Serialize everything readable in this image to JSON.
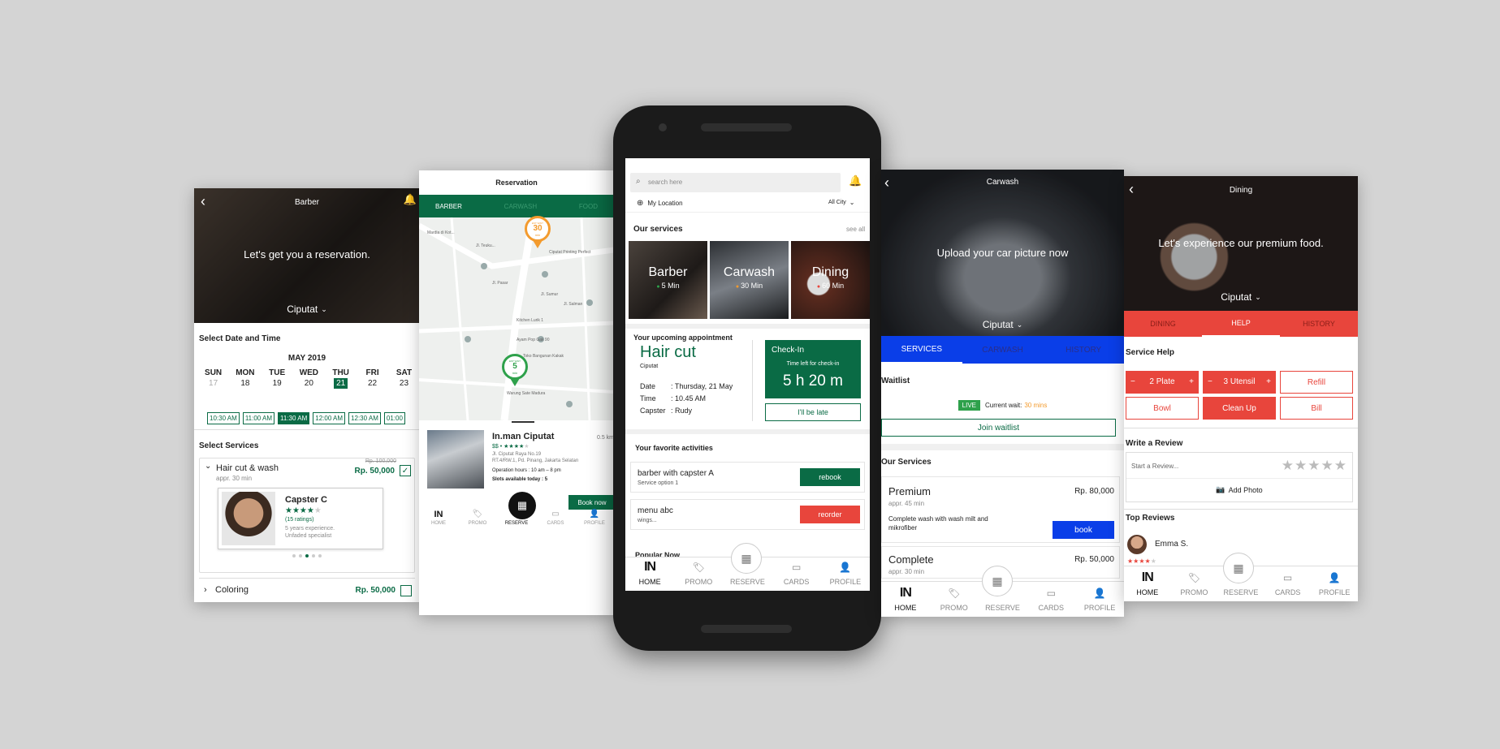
{
  "barber": {
    "title": "Barber",
    "hero_text": "Let's get you a reservation.",
    "location": "Ciputat",
    "section_date": "Select Date and Time",
    "month": "MAY  2019",
    "days": [
      "SUN",
      "MON",
      "TUE",
      "WED",
      "THU",
      "FRI",
      "SAT"
    ],
    "dates": [
      "17",
      "18",
      "19",
      "20",
      "21",
      "22",
      "23"
    ],
    "selected_date_index": 4,
    "times": [
      "10:30 AM",
      "11:00 AM",
      "11:30 AM",
      "12:00 AM",
      "12:30 AM",
      "01:00"
    ],
    "selected_time_index": 2,
    "section_services": "Select Services",
    "service1_name": "Hair cut & wash",
    "service1_time": "appr. 30 min",
    "service1_old_price": "Rp. 100,000",
    "service1_price": "Rp. 50,000",
    "capster_name": "Capster C",
    "capster_stars": "★★★★",
    "capster_star_off": "★",
    "capster_ratings": "(15 ratings)",
    "capster_desc1": "5 years experience.",
    "capster_desc2": "Unfaded specialist",
    "service2_name": "Coloring",
    "service2_price": "Rp. 50,000"
  },
  "reservation": {
    "title": "Reservation",
    "tabs": [
      "BARBER",
      "CARWASH",
      "FOOD"
    ],
    "pin1_label": "EST WAIT",
    "pin1_value": "30",
    "pin1_unit": "min",
    "pin2_label": "EST WAIT",
    "pin2_value": "5",
    "pin2_unit": "min",
    "place_name": "In.man Ciputat",
    "place_distance": "0.5 km",
    "place_price": "$$",
    "place_stars": "★★★★",
    "place_star_off": "★",
    "address1": "Jl. Ciputat Raya No.19",
    "address2": "RT.4/RW.1, Pd. Pinang, Jakarta Selatan",
    "hours": "Operation hours : 10 am – 8 pm",
    "slots": "Slots available today : 5",
    "book_now": "Book now",
    "nav": [
      "HOME",
      "PROMO",
      "RESERVE",
      "CARDS",
      "PROFILE"
    ],
    "map_labels": [
      "Mardia di Kot...",
      "Jl. Teuku...",
      "Jl. Pasar",
      "Jl. Sumur",
      "Jl. Salman",
      "Ciputat Printing Perfect",
      "Kitchen Lurik 1",
      "Ayam Pop Gak 90",
      "Toko Bangunan Kakak",
      "Warung Sate Madura"
    ]
  },
  "home": {
    "search_placeholder": "search here",
    "my_location": "My Location",
    "all_city": "All City",
    "our_services": "Our services",
    "see_all": "see all",
    "services": [
      {
        "name": "Barber",
        "wait": "5 Min",
        "dot": "#2ea14b"
      },
      {
        "name": "Carwash",
        "wait": "30 Min",
        "dot": "#f39b2e"
      },
      {
        "name": "Dining",
        "wait": "60 Min",
        "dot": "#e8453c"
      }
    ],
    "upcoming_title": "Your upcoming appointment",
    "appt_name": "Hair cut",
    "appt_location": "Ciputat",
    "appt_date_label": "Date",
    "appt_date": ": Thursday, 21 May",
    "appt_time_label": "Time",
    "appt_time": ": 10.45 AM",
    "appt_capster_label": "Capster",
    "appt_capster": ": Rudy",
    "checkin_title": "Check-In",
    "checkin_sub": "Time left for check-in",
    "checkin_time": "5 h 20 m",
    "late_button": "I'll be late",
    "fav_title": "Your favorite activities",
    "fav1_name": "barber with capster A",
    "fav1_sub": "Service option 1",
    "fav1_btn": "rebook",
    "fav2_name": "menu abc",
    "fav2_sub": "wings...",
    "fav2_btn": "reorder",
    "popular": "Popular Now",
    "logo": "IN",
    "nav": [
      "HOME",
      "PROMO",
      "RESERVE",
      "CARDS",
      "PROFILE"
    ]
  },
  "carwash": {
    "title": "Carwash",
    "hero_text": "Upload your car picture now",
    "location": "Ciputat",
    "tabs": [
      "SERVICES",
      "CARWASH",
      "HISTORY"
    ],
    "waitlist": "Waitlist",
    "live": "LIVE",
    "current_wait_label": "Current wait:",
    "current_wait": "30 mins",
    "join": "Join waitlist",
    "our_services": "Our Services",
    "s1_name": "Premium",
    "s1_price": "Rp. 80,000",
    "s1_time": "appr. 45 min",
    "s1_desc": "Complete wash with wash milt and mikrofiber",
    "s1_btn": "book",
    "s2_name": "Complete",
    "s2_price": "Rp. 50,000",
    "s2_time": "appr. 30 min",
    "logo": "IN",
    "nav": [
      "HOME",
      "PROMO",
      "RESERVE",
      "CARDS",
      "PROFILE"
    ]
  },
  "dining": {
    "title": "Dining",
    "hero_text": "Let's experience our premium food.",
    "location": "Ciputat",
    "tabs": [
      "DINING",
      "HELP",
      "HISTORY"
    ],
    "service_help": "Service Help",
    "plate": "2 Plate",
    "utensil": "3 Utensil",
    "minus": "−",
    "plus": "+",
    "refill": "Refill",
    "bowl": "Bowl",
    "cleanup": "Clean Up",
    "bill": "Bill",
    "write_review": "Write a Review",
    "review_placeholder": "Start a Review...",
    "stars": "★★★★★",
    "add_photo": "Add Photo",
    "top_reviews": "Top Reviews",
    "reviewer": "Emma S.",
    "reviewer_stars": "★★★★",
    "reviewer_star_off": "★",
    "logo": "IN",
    "nav": [
      "HOME",
      "PROMO",
      "RESERVE",
      "CARDS",
      "PROFILE"
    ]
  },
  "colors": {
    "green": "#0a6b45",
    "red": "#e8453c",
    "blue": "#0a3ee8",
    "orange": "#f39b2e"
  }
}
